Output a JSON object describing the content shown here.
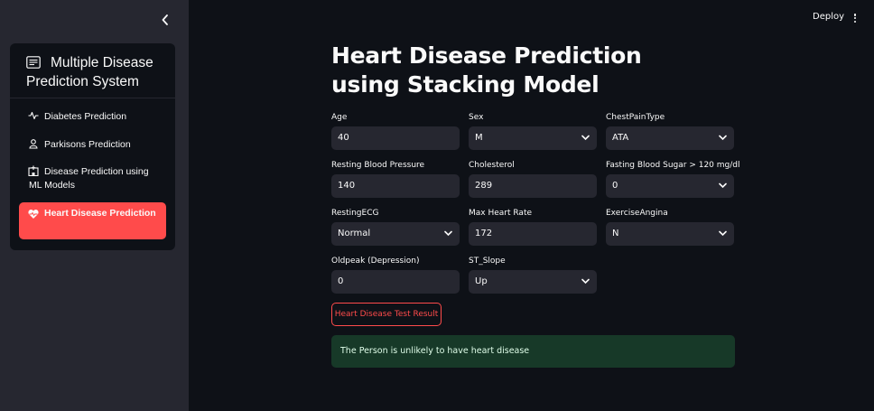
{
  "header": {
    "deploy_label": "Deploy"
  },
  "sidebar": {
    "menu_title": "Multiple Disease Prediction System",
    "items": [
      {
        "label": "Diabetes Prediction",
        "icon": "activity-icon",
        "active": false
      },
      {
        "label": "Parkisons Prediction",
        "icon": "person-icon",
        "active": false
      },
      {
        "label": "Disease Prediction using ML Models",
        "icon": "hospital-icon",
        "active": false
      },
      {
        "label": "Heart Disease Prediction",
        "icon": "heart-pulse-icon",
        "active": true
      }
    ]
  },
  "main": {
    "title": "Heart Disease Prediction using Stacking Model",
    "fields": {
      "age": {
        "label": "Age",
        "value": "40",
        "type": "text"
      },
      "sex": {
        "label": "Sex",
        "value": "M",
        "type": "select"
      },
      "chest_pain": {
        "label": "ChestPainType",
        "value": "ATA",
        "type": "select"
      },
      "resting_bp": {
        "label": "Resting Blood Pressure",
        "value": "140",
        "type": "text"
      },
      "cholesterol": {
        "label": "Cholesterol",
        "value": "289",
        "type": "text"
      },
      "fasting_bs": {
        "label": "Fasting Blood Sugar > 120 mg/dl",
        "value": "0",
        "type": "select"
      },
      "resting_ecg": {
        "label": "RestingECG",
        "value": "Normal",
        "type": "select"
      },
      "max_hr": {
        "label": "Max Heart Rate",
        "value": "172",
        "type": "text"
      },
      "exercise_angina": {
        "label": "ExerciseAngina",
        "value": "N",
        "type": "select"
      },
      "oldpeak": {
        "label": "Oldpeak (Depression)",
        "value": "0",
        "type": "text"
      },
      "st_slope": {
        "label": "ST_Slope",
        "value": "Up",
        "type": "select"
      }
    },
    "result_button_label": "Heart Disease Test Result",
    "result_message": "The Person is unlikely to have heart disease"
  },
  "colors": {
    "background": "#0e1117",
    "sidebar": "#262730",
    "accent": "#ff4b4b",
    "input_bg": "#262730",
    "success_bg": "#173928",
    "success_text": "#dffde9"
  }
}
